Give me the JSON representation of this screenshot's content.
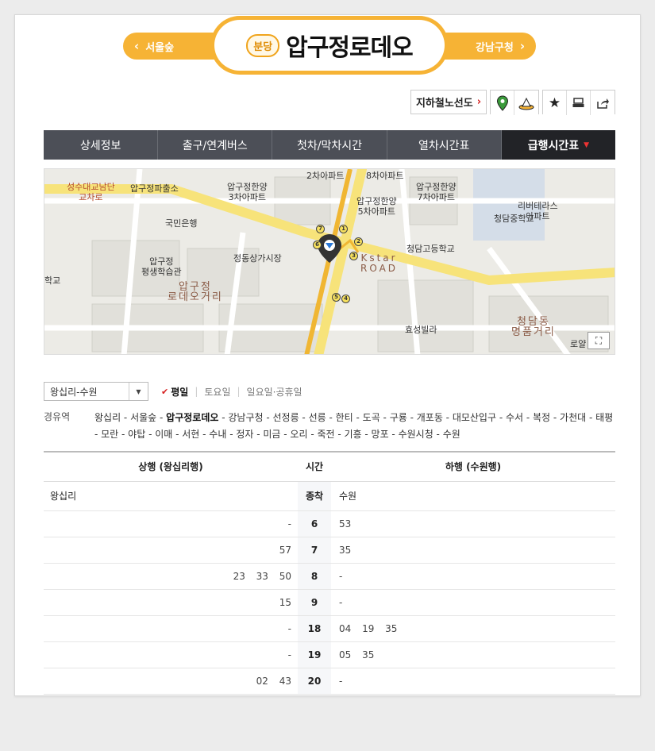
{
  "station": {
    "branch_tag": "분당",
    "name": "압구정로데오",
    "prev_station": "서울숲",
    "next_station": "강남구청"
  },
  "toolbar": {
    "subway_map_label": "지하철노선도",
    "icons": [
      "map-pin-icon",
      "subway-icon",
      "star-icon",
      "print-icon",
      "share-icon"
    ]
  },
  "tabs": [
    {
      "label": "상세정보"
    },
    {
      "label": "출구/연계버스"
    },
    {
      "label": "첫차/막차시간"
    },
    {
      "label": "열차시간표"
    },
    {
      "label": "급행시간표"
    }
  ],
  "map": {
    "labels": {
      "l1": "성수대교남단\n교차로",
      "l2": "압구정파출소",
      "l3": "압구정한양\n3차아파트",
      "l4": "2차아파트",
      "l5": "8차아파트",
      "l6": "압구정한양\n5차아파트",
      "l7": "압구정한양\n7차아파트",
      "l8": "리버테라스\n아파트",
      "l9": "국민은행",
      "l10": "청담중학교",
      "l11": "정동상가시장",
      "l12": "청담고등학교",
      "l13": "압구정\n평생학습관",
      "l14": "압구정\n로데오거리",
      "l15": "Kstar\nROAD",
      "l16": "효성빌라",
      "l17": "청담동\n명품거리",
      "l18": "학교",
      "l19": "로얄"
    },
    "exits": [
      "1",
      "2",
      "3",
      "4",
      "5",
      "6",
      "7"
    ]
  },
  "filter": {
    "direction": "왕십리-수원",
    "days": [
      "평일",
      "토요일",
      "일요일·공휴일"
    ],
    "selected_day": "평일"
  },
  "route": {
    "label": "경유역",
    "stations_before": "왕십리 - 서울숲 - ",
    "current": "압구정로데오",
    "stations_after": " - 강남구청 - 선정릉 - 선릉 - 한티 - 도곡 - 구룡 - 개포동 - 대모산입구 - 수서 - 복정 - 가천대 - 태평 - 모란 - 야탑 - 이매 - 서현 - 수내 - 정자 - 미금 - 오리 - 죽전 - 기흥 - 망포 - 수원시청 - 수원"
  },
  "timetable": {
    "headers": {
      "up": "상행 (왕십리행)",
      "time": "시간",
      "down": "하행 (수원행)"
    },
    "terminal": {
      "up": "왕십리",
      "time": "종착",
      "down": "수원"
    },
    "rows": [
      {
        "hour": "6",
        "up": "-",
        "down": "53"
      },
      {
        "hour": "7",
        "up": "57",
        "down": "35"
      },
      {
        "hour": "8",
        "up": "23 33 50",
        "down": "-"
      },
      {
        "hour": "9",
        "up": "15",
        "down": "-"
      },
      {
        "hour": "18",
        "up": "-",
        "down": "04 19 35"
      },
      {
        "hour": "19",
        "up": "-",
        "down": "05 35"
      },
      {
        "hour": "20",
        "up": "02 43",
        "down": "-"
      }
    ]
  }
}
